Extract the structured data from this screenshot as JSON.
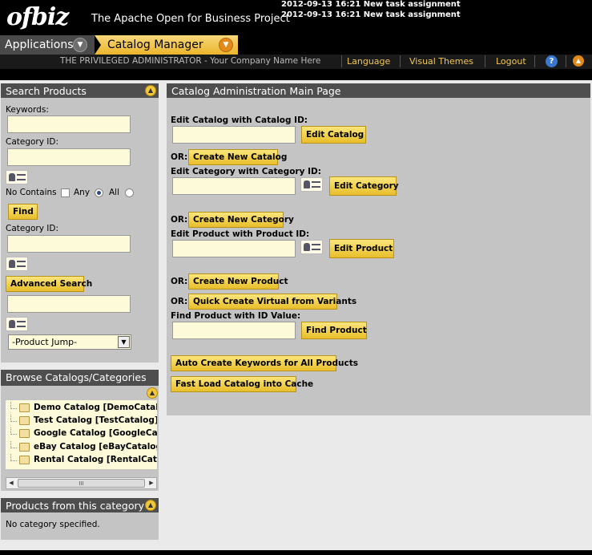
{
  "header": {
    "logo": "ofbiz",
    "tagline": "The Apache Open for Business Project",
    "messages": [
      "2012-09-13 16:21 New task assignment",
      "2012-09-13 16:21 New task assignment"
    ]
  },
  "appbar": {
    "applications_label": "Applications",
    "current_app_label": "Catalog Manager"
  },
  "userbar": {
    "user_name": "THE PRIVILEGED ADMINISTRATOR - Your Company Name Here",
    "language": "Language",
    "visual_themes": "Visual Themes",
    "logout": "Logout",
    "help": "?"
  },
  "search_products": {
    "title": "Search Products",
    "keywords_label": "Keywords:",
    "keywords_value": "",
    "category_id_label": "Category ID:",
    "category_id_value": "",
    "no_contains_label": "No Contains",
    "any_label": "Any",
    "all_label": "All",
    "find_button": "Find",
    "category_id_label_2": "Category ID:",
    "advanced_search_button": "Advanced Search",
    "product_jump_selected": "-Product Jump-"
  },
  "browse": {
    "title": "Browse Catalogs/Categories",
    "items": [
      "Demo Catalog [DemoCatalog]",
      "Test Catalog [TestCatalog]",
      "Google Catalog [GoogleCatalog]",
      "eBay Catalog [eBayCatalog]",
      "Rental Catalog [RentalCatalog]"
    ],
    "scroll_grip": "III"
  },
  "products_category": {
    "title": "Products from this category",
    "message": "No category specified."
  },
  "main": {
    "title": "Catalog Administration Main Page",
    "edit_catalog_label": "Edit Catalog with Catalog ID:",
    "edit_catalog_button": "Edit Catalog",
    "or": "OR:",
    "create_catalog_button": "Create New Catalog",
    "edit_category_label": "Edit Category with Category ID:",
    "edit_category_button": "Edit Category",
    "create_category_button": "Create New Category",
    "edit_product_label": "Edit Product with Product ID:",
    "edit_product_button": "Edit Product",
    "create_product_button": "Create New Product",
    "quick_create_button": "Quick Create Virtual from Variants",
    "find_product_label": "Find Product with ID Value:",
    "find_product_button": "Find Product",
    "auto_keywords_button": "Auto Create Keywords for All Products",
    "fast_load_button": "Fast Load Catalog into Cache"
  },
  "colors": {
    "accent_yellow": "#eab52b",
    "panel_title": "#4e4e4e",
    "panel_body": "#c4c4c4",
    "link": "#f0c850"
  },
  "icons": [
    "chevron-down-icon",
    "collapse-up-icon",
    "lookup-icon",
    "folder-icon",
    "help-icon"
  ]
}
